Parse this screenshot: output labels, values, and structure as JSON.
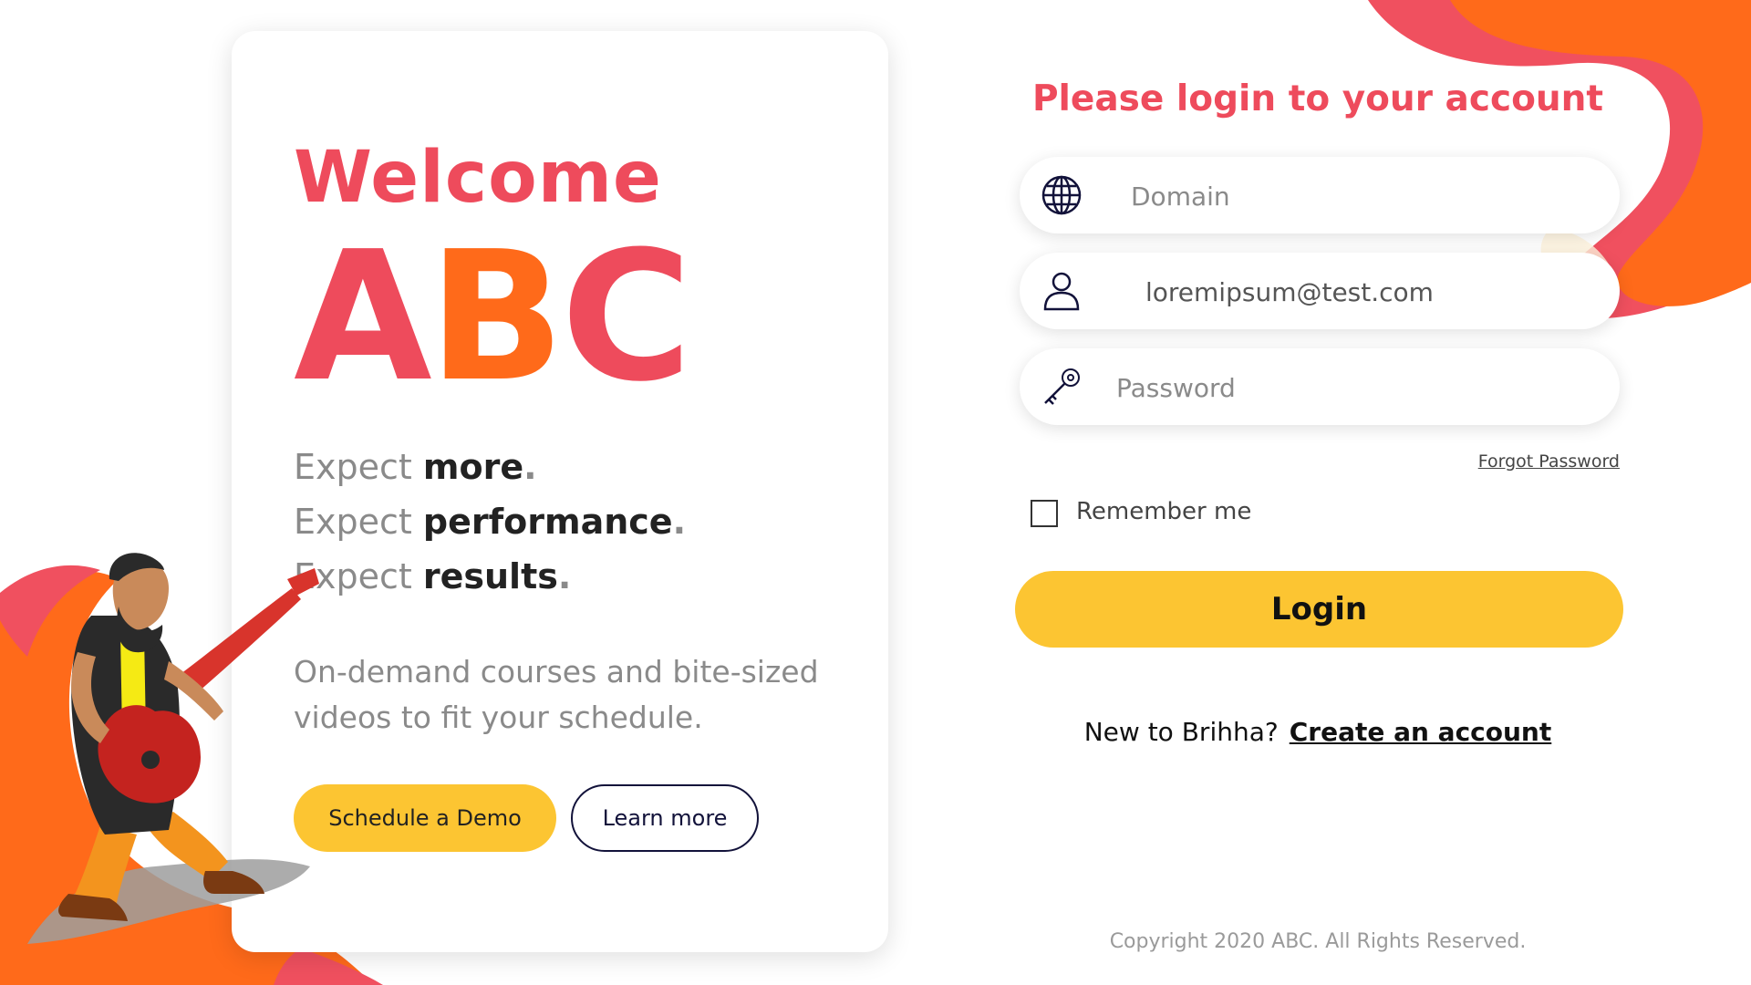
{
  "hero": {
    "welcome": "Welcome",
    "brand_parts": [
      "A",
      "B",
      "C"
    ],
    "tagline": [
      {
        "prefix": "Expect ",
        "emphasis": "more",
        "suffix": "."
      },
      {
        "prefix": "Expect ",
        "emphasis": "performance",
        "suffix": "."
      },
      {
        "prefix": "Expect ",
        "emphasis": "results",
        "suffix": "."
      }
    ],
    "description": "On-demand courses and bite-sized videos to fit your schedule.",
    "demo_label": "Schedule a Demo",
    "learn_label": "Learn more"
  },
  "login": {
    "heading": "Please login to your account",
    "domain": {
      "icon": "globe-icon",
      "placeholder": "Domain",
      "value": ""
    },
    "email": {
      "icon": "user-icon",
      "placeholder": "",
      "value": "loremipsum@test.com"
    },
    "password": {
      "icon": "key-icon",
      "placeholder": "Password",
      "value": ""
    },
    "forgot_label": "Forgot Password",
    "remember_label": "Remember me",
    "remember_checked": false,
    "login_label": "Login",
    "signup_prompt": "New to Brihha?",
    "signup_link": "Create an account"
  },
  "footer": {
    "copyright": "Copyright 2020 ABC. All Rights Reserved."
  },
  "colors": {
    "brand_red": "#ee4b5c",
    "brand_orange": "#ff6a1a",
    "accent_yellow": "#fcc532",
    "navy": "#12123a"
  },
  "illustration": {
    "icon": "guitarist-illustration-icon"
  }
}
